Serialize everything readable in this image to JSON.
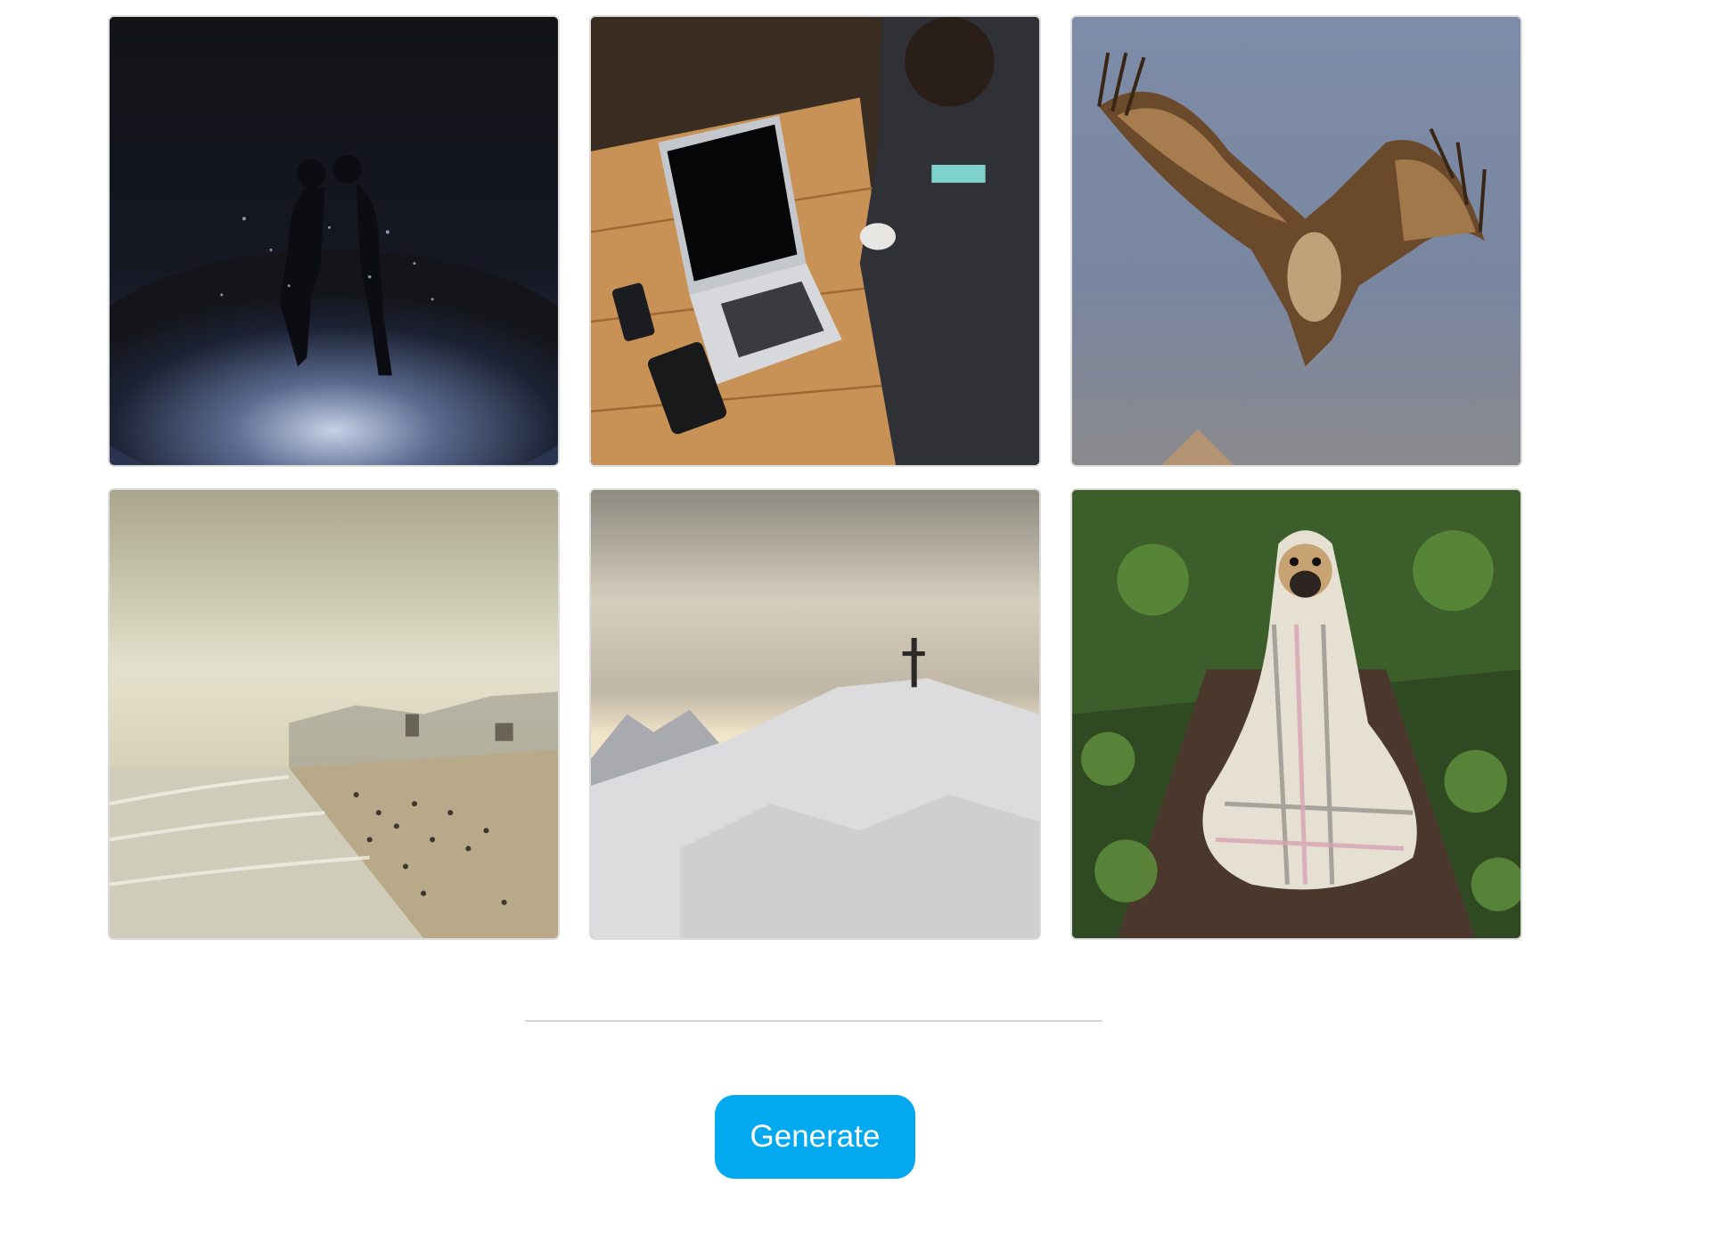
{
  "gallery": {
    "images": [
      {
        "subject": "couple-in-rain-night"
      },
      {
        "subject": "person-typing-on-laptop"
      },
      {
        "subject": "vulture-in-flight"
      },
      {
        "subject": "beach-with-crowd"
      },
      {
        "subject": "snowy-mountain-cross"
      },
      {
        "subject": "pug-in-blanket"
      }
    ]
  },
  "actions": {
    "generate_label": "Generate"
  },
  "colors": {
    "accent": "#03a9ee",
    "divider": "#d6d6d6",
    "tile_border": "#dcdcdc"
  }
}
